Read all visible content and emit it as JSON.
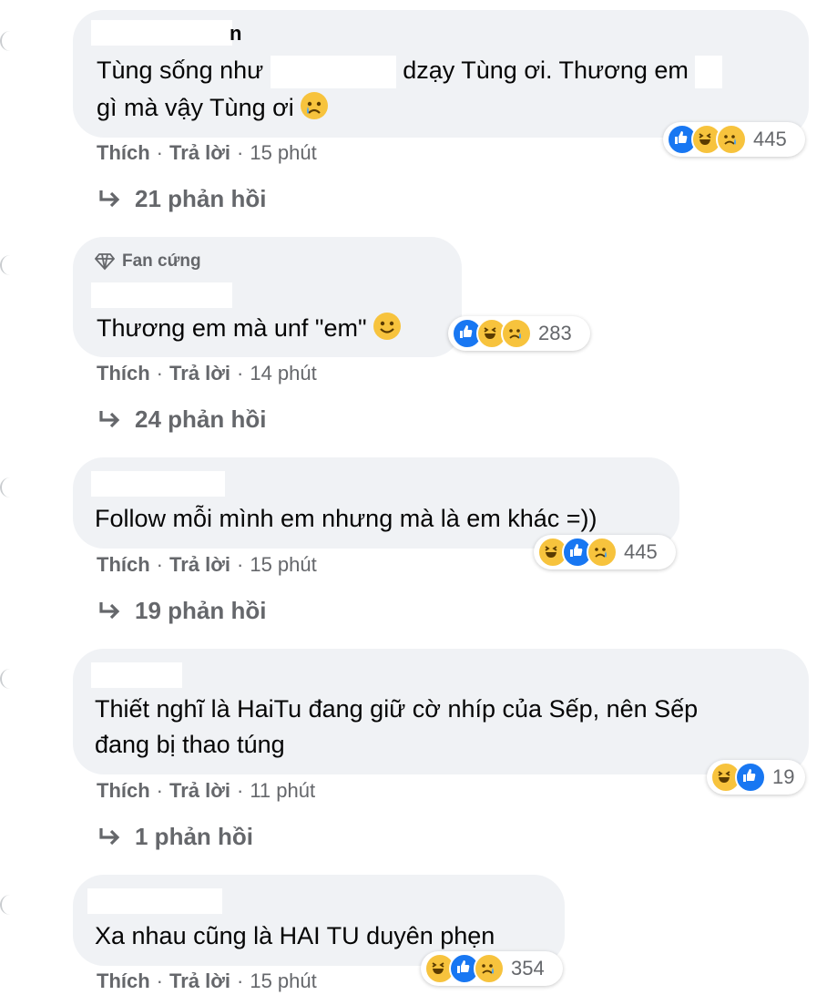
{
  "comments": [
    {
      "line1_a": "Tùng sống như",
      "line1_b": "dzạy Tùng ơi. Thương em",
      "line2": "gì mà vậy Tùng ơi",
      "name_tail": "n",
      "reaction_count": "445",
      "meta": {
        "like": "Thích",
        "reply": "Trả lời",
        "time": "15 phút"
      },
      "replies": "21 phản hồi"
    },
    {
      "badge": "Fan cứng",
      "text": "Thương em mà unf \"em\"",
      "reaction_count": "283",
      "meta": {
        "like": "Thích",
        "reply": "Trả lời",
        "time": "14 phút"
      },
      "replies": "24 phản hồi"
    },
    {
      "text": "Follow mỗi mình em nhưng mà là em khác =))",
      "reaction_count": "445",
      "meta": {
        "like": "Thích",
        "reply": "Trả lời",
        "time": "15 phút"
      },
      "replies": "19 phản hồi"
    },
    {
      "line1": "Thiết nghĩ là HaiTu đang giữ cờ nhíp của Sếp, nên Sếp",
      "line2": "đang bị thao túng",
      "reaction_count": "19",
      "meta": {
        "like": "Thích",
        "reply": "Trả lời",
        "time": "11 phút"
      },
      "replies": "1 phản hồi"
    },
    {
      "text": "Xa nhau cũng là HAI TU duyên phẹn",
      "reaction_count": "354",
      "meta": {
        "like": "Thích",
        "reply": "Trả lời",
        "time": "15 phút"
      }
    }
  ],
  "colors": {
    "bubble": "#f0f2f5",
    "meta": "#65676b",
    "like": "#1877f2",
    "emoji": "#f7c33d"
  },
  "icons": [
    "reply-arrow-icon",
    "diamond-icon",
    "like-reaction-icon",
    "haha-reaction-icon",
    "sad-reaction-icon",
    "crying-emoji-icon",
    "smile-emoji-icon"
  ]
}
